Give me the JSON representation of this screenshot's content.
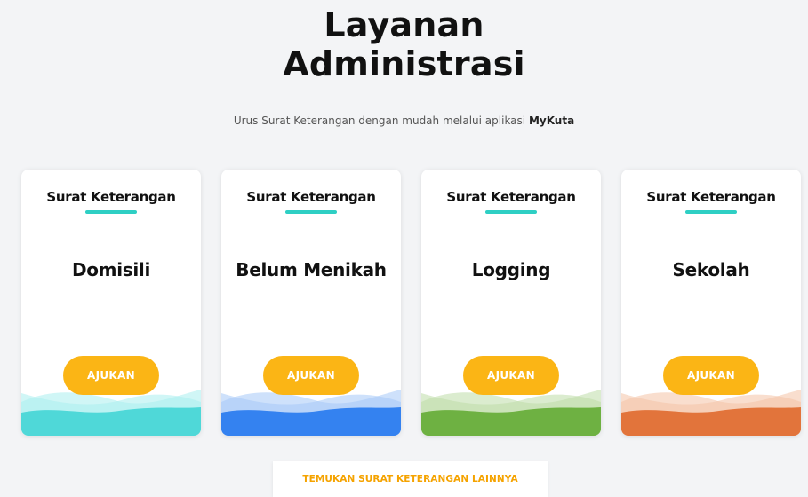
{
  "header": {
    "title_line1": "Layanan",
    "title_line2": "Administrasi",
    "subtitle_prefix": "Urus Surat Keterangan dengan mudah melalui aplikasi ",
    "subtitle_app": "MyKuta"
  },
  "cards": [
    {
      "label": "Surat Keterangan",
      "name": "Domisili",
      "button_label": "AJUKAN",
      "accent_color": "#4fd8d8",
      "wave_light_color": "#a9eeee"
    },
    {
      "label": "Surat Keterangan",
      "name": "Belum Menikah",
      "button_label": "AJUKAN",
      "accent_color": "#3482f0",
      "wave_light_color": "#a6c9f8"
    },
    {
      "label": "Surat Keterangan",
      "name": "Logging",
      "button_label": "AJUKAN",
      "accent_color": "#6eb142",
      "wave_light_color": "#bddca8"
    },
    {
      "label": "Surat Keterangan",
      "name": "Sekolah",
      "button_label": "AJUKAN",
      "accent_color": "#e2743b",
      "wave_light_color": "#f4c2a6"
    }
  ],
  "colors": {
    "underline": "#2ecfc4",
    "button": "#fbb515",
    "more_text": "#f5a300"
  },
  "footer": {
    "more_label": "TEMUKAN SURAT KETERANGAN LAINNYA"
  }
}
